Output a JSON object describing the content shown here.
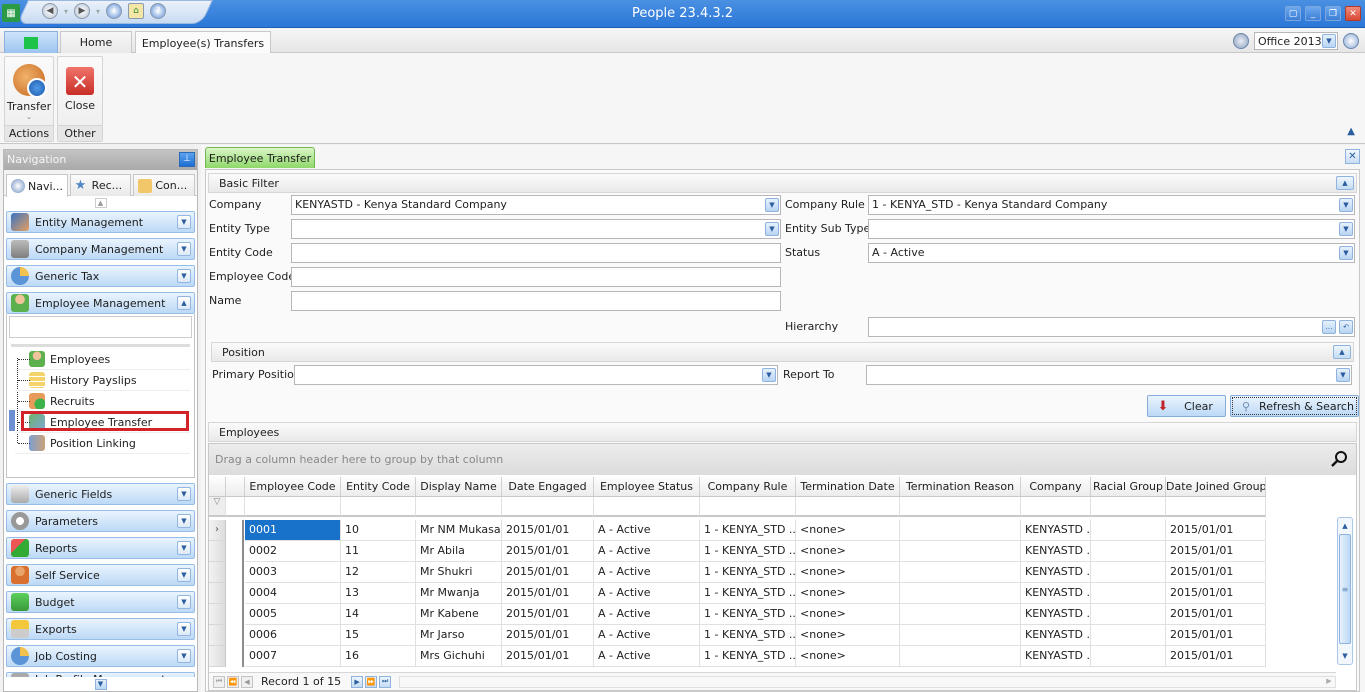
{
  "window": {
    "title": "People 23.4.3.2",
    "quick_access": [
      "back-icon",
      "forward-icon",
      "info-icon",
      "home-icon",
      "help-icon"
    ]
  },
  "ribbon": {
    "tabs": [
      {
        "label": "Home",
        "active": false
      },
      {
        "label": "Employee(s) Transfers",
        "active": true
      }
    ],
    "skin": {
      "selected": "Office 2013"
    },
    "groups": [
      {
        "caption": "Actions",
        "button": "Transfer"
      },
      {
        "caption": "Other",
        "button": "Close"
      }
    ]
  },
  "navigation": {
    "title": "Navigation",
    "tabs": [
      "Navi...",
      "Rec...",
      "Con..."
    ],
    "groups_top": [
      {
        "label": "Entity Management",
        "expanded": false
      },
      {
        "label": "Company Management",
        "expanded": false
      },
      {
        "label": "Generic Tax",
        "expanded": false
      },
      {
        "label": "Employee Management",
        "expanded": true
      }
    ],
    "employee_management_items": [
      {
        "label": "Employees"
      },
      {
        "label": "History Payslips"
      },
      {
        "label": "Recruits"
      },
      {
        "label": "Employee Transfer",
        "selected": true
      },
      {
        "label": "Position Linking"
      }
    ],
    "groups_bottom": [
      {
        "label": "Generic Fields"
      },
      {
        "label": "Parameters"
      },
      {
        "label": "Reports"
      },
      {
        "label": "Self Service"
      },
      {
        "label": "Budget"
      },
      {
        "label": "Exports"
      },
      {
        "label": "Job Costing"
      },
      {
        "label": "Job Profile Management"
      }
    ]
  },
  "document": {
    "tab": "Employee Transfer",
    "basic_filter": {
      "title": "Basic Filter",
      "company": {
        "label": "Company",
        "value": "KENYASTD - Kenya Standard Company"
      },
      "entity_type": {
        "label": "Entity Type",
        "value": ""
      },
      "entity_code": {
        "label": "Entity Code",
        "value": ""
      },
      "employee_code": {
        "label": "Employee Code",
        "value": ""
      },
      "name": {
        "label": "Name",
        "value": ""
      },
      "company_rule": {
        "label": "Company Rule",
        "value": "1 - KENYA_STD - Kenya Standard Company"
      },
      "entity_sub_type": {
        "label": "Entity Sub Type",
        "value": ""
      },
      "status": {
        "label": "Status",
        "value": "A - Active"
      },
      "hierarchy": {
        "label": "Hierarchy",
        "value": ""
      }
    },
    "position": {
      "title": "Position",
      "primary_position": {
        "label": "Primary Position",
        "value": ""
      },
      "report_to": {
        "label": "Report To",
        "value": ""
      }
    },
    "buttons": {
      "clear": "Clear",
      "refresh": "Refresh & Search"
    },
    "employees": {
      "title": "Employees",
      "group_hint": "Drag a column header here to group by that column",
      "columns": [
        "Employee Code",
        "Entity Code",
        "Display Name",
        "Date Engaged",
        "Employee Status",
        "Company Rule",
        "Termination Date",
        "Termination Reason",
        "Company",
        "Racial Group",
        "Date Joined Group"
      ],
      "rows": [
        [
          "0001",
          "10",
          "Mr NM Mukasa",
          "2015/01/01",
          "A - Active",
          "1 - KENYA_STD ...",
          "<none>",
          "",
          "KENYASTD ...",
          "",
          "2015/01/01"
        ],
        [
          "0002",
          "11",
          "Mr  Abila",
          "2015/01/01",
          "A - Active",
          "1 - KENYA_STD ...",
          "<none>",
          "",
          "KENYASTD ...",
          "",
          "2015/01/01"
        ],
        [
          "0003",
          "12",
          "Mr  Shukri",
          "2015/01/01",
          "A - Active",
          "1 - KENYA_STD ...",
          "<none>",
          "",
          "KENYASTD ...",
          "",
          "2015/01/01"
        ],
        [
          "0004",
          "13",
          "Mr  Mwanja",
          "2015/01/01",
          "A - Active",
          "1 - KENYA_STD ...",
          "<none>",
          "",
          "KENYASTD ...",
          "",
          "2015/01/01"
        ],
        [
          "0005",
          "14",
          "Mr  Kabene",
          "2015/01/01",
          "A - Active",
          "1 - KENYA_STD ...",
          "<none>",
          "",
          "KENYASTD ...",
          "",
          "2015/01/01"
        ],
        [
          "0006",
          "15",
          "Mr  Jarso",
          "2015/01/01",
          "A - Active",
          "1 - KENYA_STD ...",
          "<none>",
          "",
          "KENYASTD ...",
          "",
          "2015/01/01"
        ],
        [
          "0007",
          "16",
          "Mrs  Gichuhi",
          "2015/01/01",
          "A - Active",
          "1 - KENYA_STD ...",
          "<none>",
          "",
          "KENYASTD ...",
          "",
          "2015/01/01"
        ]
      ],
      "record_text": "Record 1 of 15"
    }
  }
}
